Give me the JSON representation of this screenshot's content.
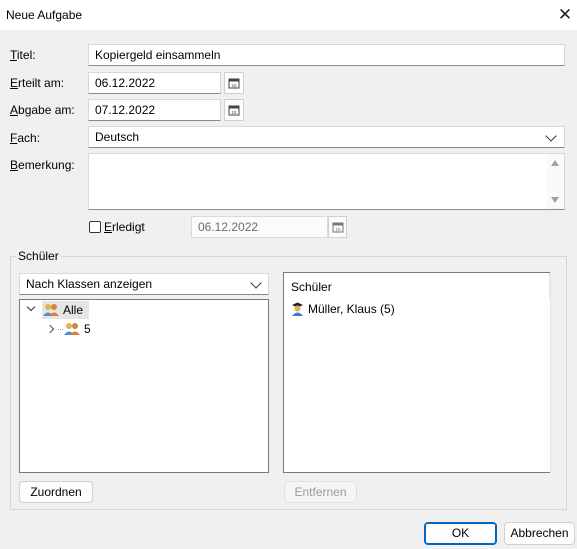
{
  "window": {
    "title": "Neue Aufgabe"
  },
  "form": {
    "titel": {
      "label_key": "T",
      "label_rest": "itel:",
      "value": "Kopiergeld einsammeln"
    },
    "erteilt": {
      "label_key": "E",
      "label_rest": "rteilt am:",
      "value": "06.12.2022"
    },
    "abgabe": {
      "label_key": "A",
      "label_rest": "bgabe am:",
      "value": "07.12.2022"
    },
    "fach": {
      "label_key": "F",
      "label_rest": "ach:",
      "value": "Deutsch"
    },
    "bemerkung": {
      "label_key": "B",
      "label_rest": "emerkung:",
      "value": ""
    },
    "erledigt": {
      "label_key": "E",
      "label_rest": "rledigt",
      "checked": false,
      "date": "06.12.2022"
    }
  },
  "schueler_group": {
    "title_key": "S",
    "title_rest": "chüler",
    "filter_value": "Nach Klassen anzeigen",
    "tree": [
      {
        "label": "Alle",
        "expanded": true,
        "selected": true
      },
      {
        "label": "5",
        "expanded": false,
        "selected": false
      }
    ],
    "list_header": "Schüler",
    "list_items": [
      {
        "label": "Müller, Klaus (5)"
      }
    ],
    "assign_button": "Zuordnen",
    "remove_button": "Entfernen"
  },
  "buttons": {
    "ok": "OK",
    "cancel": "Abbrechen"
  },
  "colors": {
    "accent": "#0067c0",
    "selection": "#cce8ff",
    "tree_selected_bg": "#e5e5e5"
  }
}
